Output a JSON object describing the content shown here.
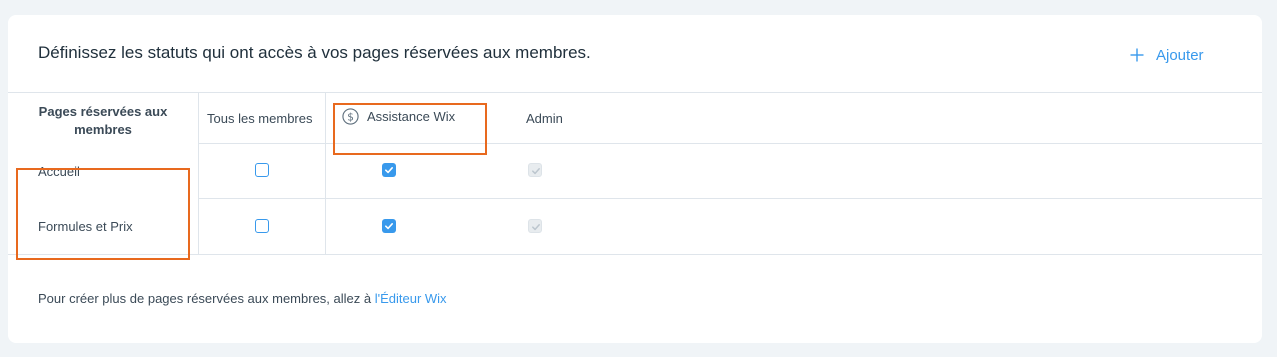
{
  "header": {
    "title": "Définissez les statuts qui ont accès à vos pages réservées aux membres.",
    "add_label": "Ajouter",
    "add_icon": "plus-icon"
  },
  "table": {
    "first_column_header": [
      "Pages réservées aux",
      "membres"
    ],
    "columns": [
      {
        "label": "Tous les membres"
      },
      {
        "label": "Assistance Wix",
        "icon": "dollar-icon"
      },
      {
        "label": "Admin"
      }
    ],
    "rows": [
      {
        "label": "Accueil",
        "states": [
          "unchecked",
          "checked",
          "disabled-checked"
        ]
      },
      {
        "label": "Formules et Prix",
        "states": [
          "unchecked",
          "checked",
          "disabled-checked"
        ]
      }
    ]
  },
  "footer": {
    "text": "Pour créer plus de pages réservées aux membres, allez à ",
    "link": "l'Éditeur Wix"
  },
  "colors": {
    "accent": "#3899ec",
    "highlight": "#e8691e",
    "background": "#f0f4f7"
  }
}
